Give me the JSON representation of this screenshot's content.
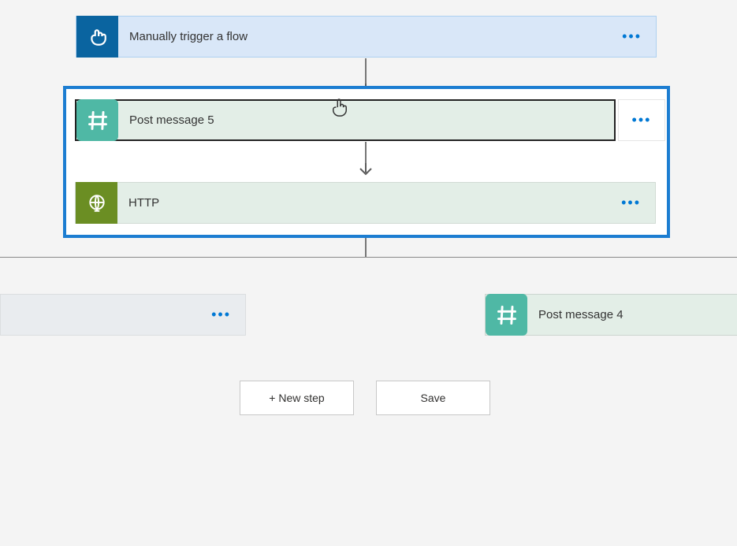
{
  "trigger": {
    "label": "Manually trigger a flow"
  },
  "selected_group": {
    "step1_label": "Post message 5",
    "step2_label": "HTTP"
  },
  "branch_right": {
    "label": "Post message 4"
  },
  "buttons": {
    "new_step": "+ New step",
    "save": "Save"
  },
  "icons": {
    "trigger": "manual-trigger-icon",
    "slack": "slack-hash-icon",
    "http": "http-globe-icon"
  }
}
